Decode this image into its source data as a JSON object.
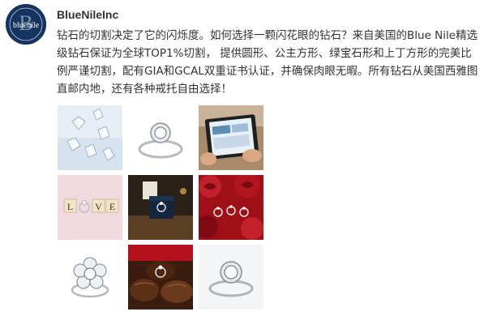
{
  "post": {
    "username": "BlueNileInc",
    "avatar_text": "bluenile",
    "text": "钻石的切割决定了它的闪烁度。如何选择一颗闪花眼的钻石？来自美国的Blue Nile精选级钻石保证为全球TOP1%切割， 提供圆形、公主方形、绿宝石形和上丁方形的完美比例严谨切割，配有GIA和GCAL双重证书认证，并确保肉眼无暇。所有钻石从美国西雅图直邮内地，还有各种戒托自由选择！"
  },
  "photos": [
    {
      "name": "photo-loose-diamonds",
      "icon": "diamonds-image"
    },
    {
      "name": "photo-halo-ring",
      "icon": "ring-image"
    },
    {
      "name": "photo-tablet",
      "icon": "tablet-image"
    },
    {
      "name": "photo-love-tiles",
      "icon": "tiles-image",
      "tile_letters": [
        "L",
        "V",
        "E"
      ]
    },
    {
      "name": "photo-ring-box",
      "icon": "ring-box-image"
    },
    {
      "name": "photo-rings-roses",
      "icon": "roses-image"
    },
    {
      "name": "photo-flower-ring",
      "icon": "flower-ring-image"
    },
    {
      "name": "photo-chocolate-ring",
      "icon": "chocolate-image"
    },
    {
      "name": "photo-halo-ring-2",
      "icon": "ring-image"
    }
  ],
  "colors": {
    "avatar_bg": "#15345f",
    "text": "#333333"
  }
}
